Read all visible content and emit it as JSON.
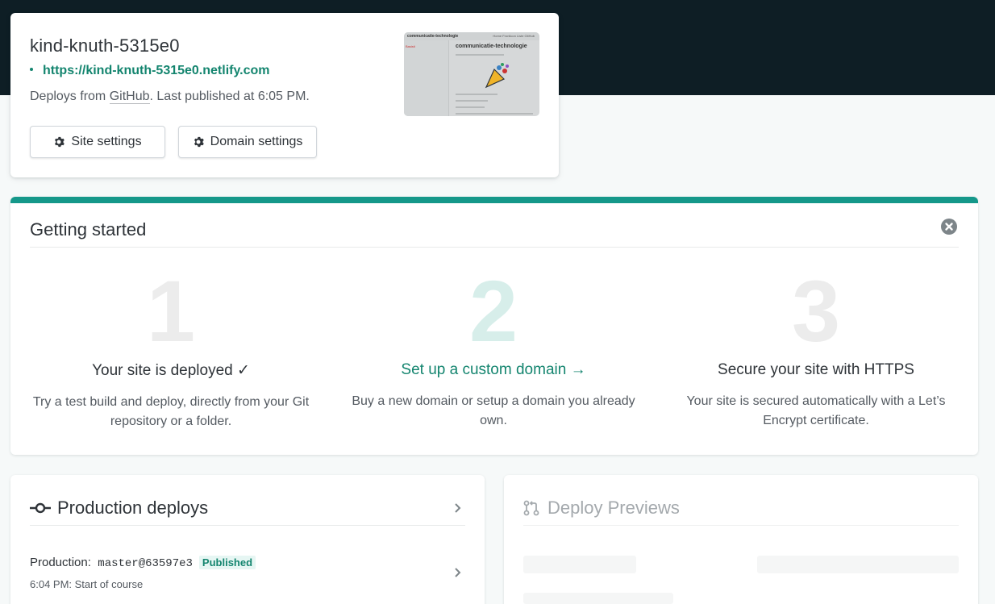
{
  "site": {
    "name": "kind-knuth-5315e0",
    "url": "https://kind-knuth-5315e0.netlify.com",
    "meta_prefix": "Deploys from ",
    "meta_source": "GitHub",
    "meta_suffix": ". Last published at 6:05 PM.",
    "buttons": {
      "site_settings": "Site settings",
      "domain_settings": "Domain settings"
    },
    "thumbnail": {
      "brand": "communicatie-technologie",
      "title": "communicatie-technologie",
      "nav": "Home  Fronticon  Liste  GitHub",
      "side_label": "Basisti"
    }
  },
  "getting_started": {
    "title": "Getting started",
    "close_icon": "close-circle-icon",
    "steps": [
      {
        "number": "1",
        "heading": "Your site is deployed ✓",
        "description": "Try a test build and deploy, directly from your Git repository or a folder."
      },
      {
        "number": "2",
        "heading": "Set up a custom domain →",
        "description": "Buy a new domain or setup a domain you already own."
      },
      {
        "number": "3",
        "heading": "Secure your site with HTTPS",
        "description": "Your site is secured automatically with a Let’s Encrypt certificate."
      }
    ]
  },
  "production_deploys": {
    "title": "Production deploys",
    "icon": "git-commit-icon",
    "row": {
      "label": "Production:",
      "ref": " master@63597e3",
      "badge": "Published",
      "time": "6:04 PM: Start of course"
    }
  },
  "deploy_previews": {
    "title": "Deploy Previews",
    "icon": "git-pull-request-icon"
  },
  "colors": {
    "accent": "#14856f",
    "header_band": "#0e1e25",
    "progress_bar": "#15988a"
  }
}
